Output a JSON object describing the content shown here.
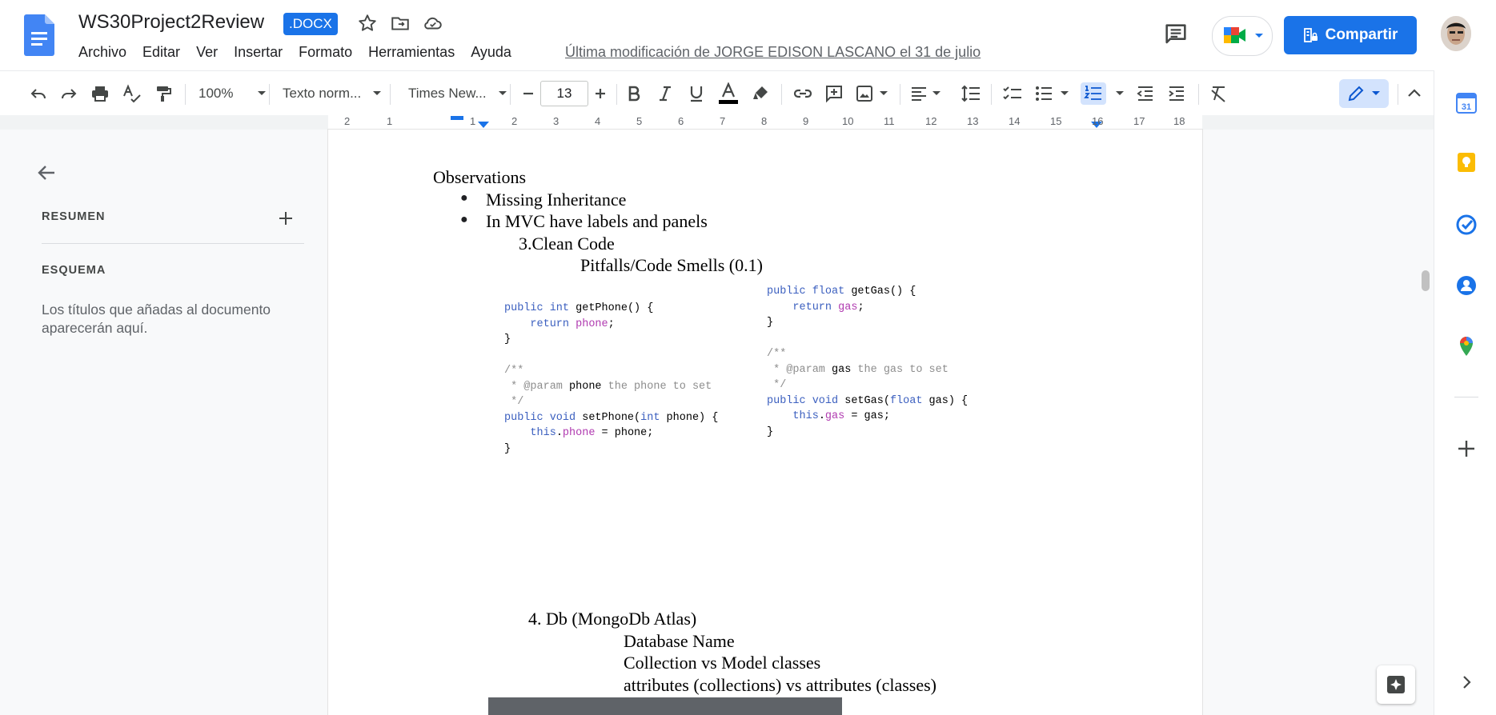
{
  "header": {
    "doc_title": "WS30Project2Review",
    "format_badge": ".DOCX",
    "menu": [
      "Archivo",
      "Editar",
      "Ver",
      "Insertar",
      "Formato",
      "Herramientas",
      "Ayuda"
    ],
    "last_edit": "Última modificación de JORGE EDISON LASCANO el 31 de julio",
    "share_label": "Compartir"
  },
  "toolbar": {
    "zoom": "100%",
    "style": "Texto norm...",
    "font": "Times New...",
    "font_size": "13"
  },
  "ruler": {
    "numbers": [
      "2",
      "1",
      "1",
      "2",
      "3",
      "4",
      "5",
      "6",
      "7",
      "8",
      "9",
      "10",
      "11",
      "12",
      "13",
      "14",
      "15",
      "16",
      "17",
      "18"
    ]
  },
  "outline": {
    "summary_label": "RESUMEN",
    "outline_label": "ESQUEMA",
    "hint": "Los títulos que añadas al documento aparecerán aquí."
  },
  "document": {
    "observations": "Observations",
    "bullets": [
      "Missing Inheritance",
      "In MVC have labels and panels"
    ],
    "clean_code": "3.Clean Code",
    "pitfalls": "Pitfalls/Code Smells (0.1)",
    "code_left": {
      "l1_kw": "public int ",
      "l1_name": "getPhone",
      "l1_rest": "() {",
      "l2_kw": "return ",
      "l2_field": "phone",
      "l2_rest": ";",
      "l3": "}",
      "l5": "/**",
      "l6_a": " * @param ",
      "l6_b": "phone",
      "l6_c": " the phone to set",
      "l7": " */",
      "l8_kw": "public void ",
      "l8_name": "setPhone",
      "l8_a": "(",
      "l8_kw2": "int",
      "l8_b": " phone) {",
      "l9_kw": "this",
      "l9_a": ".",
      "l9_field": "phone",
      "l9_b": " = phone;",
      "l10": "}"
    },
    "code_right": {
      "l1_kw": "public float ",
      "l1_name": "getGas",
      "l1_rest": "() {",
      "l2_kw": "return ",
      "l2_field": "gas",
      "l2_rest": ";",
      "l3": "}",
      "l5": "/**",
      "l6_a": " * @param ",
      "l6_b": "gas",
      "l6_c": " the gas to set",
      "l7": " */",
      "l8_kw": "public void ",
      "l8_name": "setGas",
      "l8_a": "(",
      "l8_kw2": "float",
      "l8_b": " gas) {",
      "l9_kw": "this",
      "l9_a": ".",
      "l9_field": "gas",
      "l9_b": " = gas;",
      "l10": "}"
    },
    "db_heading": "4. Db (MongoDb Atlas)",
    "db_items": [
      "Database Name",
      "Collection vs Model classes",
      "attributes (collections) vs attributes (classes)"
    ]
  },
  "colors": {
    "accent": "#1a73e8",
    "code_keyword": "#3b5fbf",
    "code_field": "#b03ab0",
    "code_comment": "#8d8d8d"
  },
  "icons": [
    "docs-logo",
    "star-icon",
    "move-folder-icon",
    "cloud-saved-icon",
    "comments-icon",
    "meet-icon",
    "lock-people-icon",
    "undo-icon",
    "redo-icon",
    "print-icon",
    "spellcheck-icon",
    "paint-format-icon",
    "bold-icon",
    "italic-icon",
    "underline-icon",
    "text-color-icon",
    "highlight-icon",
    "link-icon",
    "add-comment-icon",
    "image-icon",
    "align-icon",
    "line-spacing-icon",
    "checklist-icon",
    "bulleted-list-icon",
    "numbered-list-icon",
    "decrease-indent-icon",
    "increase-indent-icon",
    "clear-format-icon",
    "pencil-icon",
    "calendar-icon",
    "keep-icon",
    "tasks-icon",
    "contacts-icon",
    "maps-icon",
    "plus-icon",
    "explore-icon"
  ]
}
